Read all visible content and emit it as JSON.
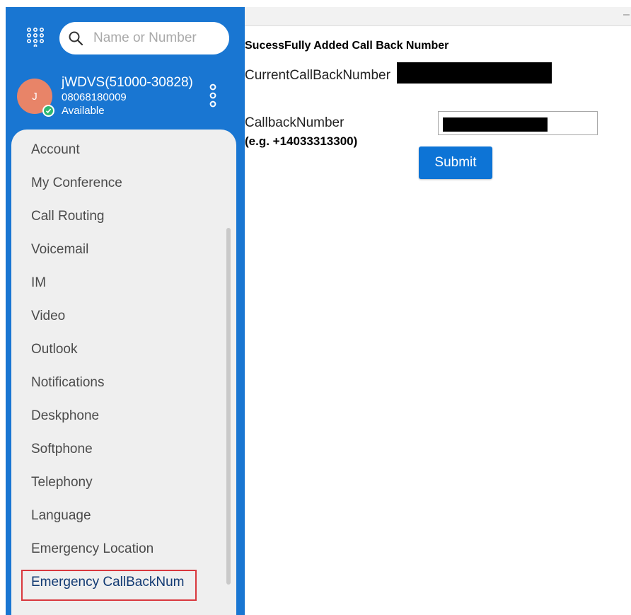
{
  "colors": {
    "sidebar_bg": "#1976d2",
    "menu_panel_bg": "#efefef",
    "avatar_bg": "#e88468",
    "presence": "#2eb872",
    "highlight_border": "#d9383e",
    "submit_bg": "#0d74d6"
  },
  "search": {
    "placeholder": "Name or Number",
    "icon": "search-icon"
  },
  "user": {
    "initial": "J",
    "name": "jWDVS(51000-30828)",
    "phone": "08068180009",
    "status": "Available"
  },
  "menu": {
    "items": [
      "Account",
      "My Conference",
      "Call Routing",
      "Voicemail",
      "IM",
      "Video",
      "Outlook",
      "Notifications",
      "Deskphone",
      "Softphone",
      "Telephony",
      "Language",
      "Emergency Location",
      "Emergency CallBackNum"
    ],
    "selected": "Emergency CallBackNum"
  },
  "window": {
    "minimize": "–"
  },
  "form": {
    "success_message": "SucessFully Added Call Back Number",
    "current_label": "CurrentCallBackNumber",
    "callback_label": "CallbackNumber",
    "callback_example": "(e.g. +14033313300)",
    "callback_value": "",
    "submit_label": "Submit"
  }
}
